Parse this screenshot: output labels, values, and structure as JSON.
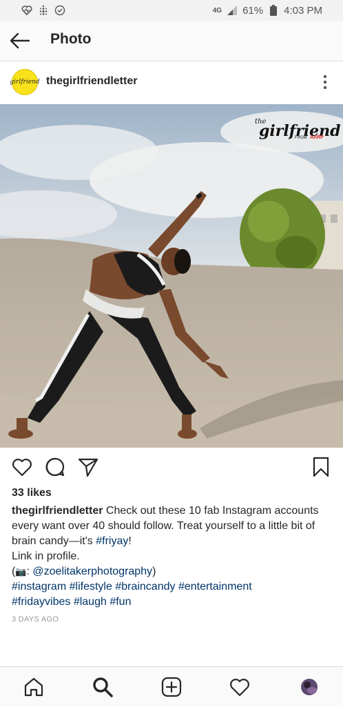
{
  "status_bar": {
    "battery": "61%",
    "time": "4:03 PM",
    "network": "4G"
  },
  "app_bar": {
    "title": "Photo"
  },
  "post": {
    "username": "thegirlfriendletter",
    "avatar_text": "girlfriend",
    "image_logo": {
      "the": "the",
      "brand": "girlfriend",
      "from": "FROM",
      "aarp": "AARP"
    },
    "likes": "33 likes",
    "caption": {
      "username": "thegirlfriendletter",
      "text": "Check out these 10 fab Instagram accounts every want over 40 should follow. Treat yourself to a little bit of brain candy—it's",
      "tag_friyay": "#friyay",
      "exclaim": "!",
      "line2": "Link in profile.",
      "credit_prefix": "(",
      "credit_emoji": "📷",
      "credit_colon": ": ",
      "credit_handle": "@zoelitakerphotography",
      "credit_suffix": ")",
      "hashtags_line1": [
        "#instagram",
        "#lifestyle",
        "#braincandy",
        "#entertainment"
      ],
      "hashtags_line2": [
        "#fridayvibes",
        "#laugh",
        "#fun"
      ]
    },
    "date": "3 DAYS AGO"
  },
  "icons": {
    "back": "back-arrow-icon",
    "more": "more-vertical-icon",
    "like": "heart-icon",
    "comment": "comment-icon",
    "share": "send-icon",
    "save": "bookmark-icon",
    "home": "home-icon",
    "search": "search-icon",
    "add": "add-post-icon",
    "activity": "heart-icon",
    "profile": "profile-avatar"
  },
  "colors": {
    "hashtag": "#003569",
    "text": "#262626",
    "avatar_bg": "#f9e21b",
    "aarp_red": "#e2231a"
  }
}
